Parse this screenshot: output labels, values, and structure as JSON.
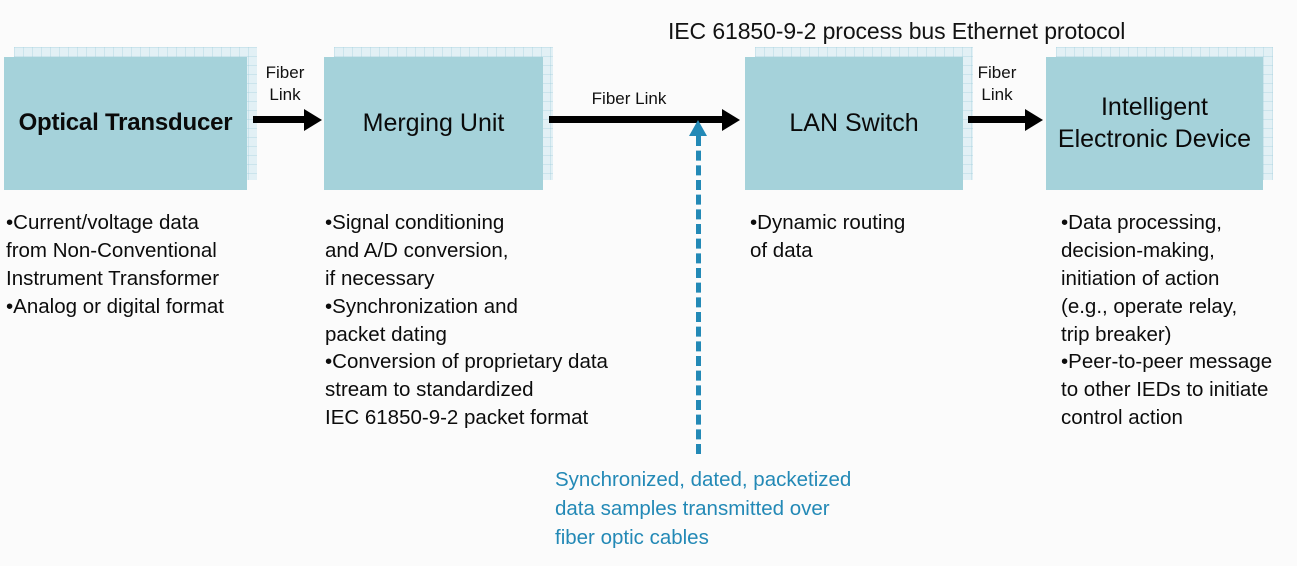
{
  "header": {
    "title": "IEC 61850-9-2 process bus Ethernet protocol"
  },
  "nodes": [
    {
      "name": "optical-transducer",
      "label": "Optical\nTransducer"
    },
    {
      "name": "merging-unit",
      "label": "Merging Unit"
    },
    {
      "name": "lan-switch",
      "label": "LAN\nSwitch"
    },
    {
      "name": "intelligent-electronic-device",
      "label": "Intelligent\nElectronic\nDevice"
    }
  ],
  "links": [
    {
      "name": "link-transducer-to-merging-unit",
      "label": "Fiber\nLink"
    },
    {
      "name": "link-merging-unit-to-switch",
      "label": "Fiber Link"
    },
    {
      "name": "link-switch-to-ied",
      "label": "Fiber\nLink"
    }
  ],
  "details": [
    {
      "name": "optical-transducer-details",
      "text": "•Current/voltage data\n from Non-Conventional\n Instrument Transformer\n•Analog or digital format"
    },
    {
      "name": "merging-unit-details",
      "text": "•Signal conditioning\nand A/D conversion,\n if necessary\n•Synchronization and\npacket dating\n•Conversion of proprietary data\nstream to standardized\nIEC 61850-9-2 packet format"
    },
    {
      "name": "lan-switch-details",
      "text": "•Dynamic routing\nof data"
    },
    {
      "name": "ied-details",
      "text": "•Data processing,\ndecision-making,\ninitiation of action\n(e.g., operate relay,\ntrip breaker)\n•Peer-to-peer message\nto other IEDs to initiate\ncontrol action"
    }
  ],
  "annotation": {
    "text": "Synchronized, dated, packetized\ndata samples transmitted over\nfiber optic cables"
  },
  "colors": {
    "node_fill": "#a5d2da",
    "node_shadow": "#e2f0f5",
    "annotation": "#2389b6",
    "arrow": "#000000",
    "background": "#fbfbfb"
  }
}
